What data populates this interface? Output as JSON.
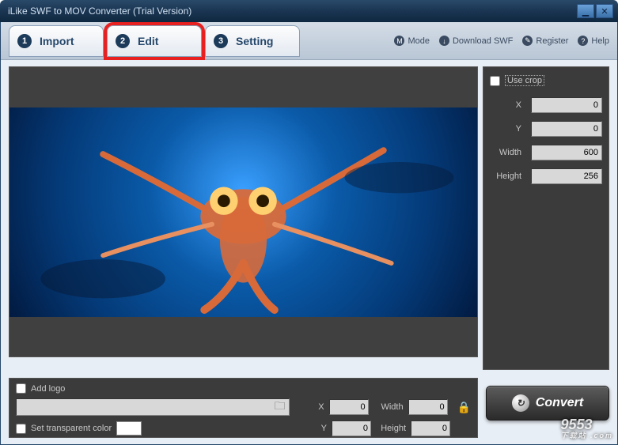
{
  "titlebar": {
    "title": "iLike SWF to MOV Converter (Trial Version)"
  },
  "tabs": {
    "import": {
      "num": "1",
      "label": "Import"
    },
    "edit": {
      "num": "2",
      "label": "Edit"
    },
    "setting": {
      "num": "3",
      "label": "Setting"
    }
  },
  "menu": {
    "mode": {
      "icon": "M",
      "label": "Mode"
    },
    "download": {
      "icon": "↓",
      "label": "Download SWF"
    },
    "register": {
      "icon": "✎",
      "label": "Register"
    },
    "help": {
      "icon": "?",
      "label": "Help"
    }
  },
  "crop": {
    "use_label": "Use crop",
    "x_label": "X",
    "x_value": "0",
    "y_label": "Y",
    "y_value": "0",
    "w_label": "Width",
    "w_value": "600",
    "h_label": "Height",
    "h_value": "256"
  },
  "logo": {
    "add_label": "Add logo",
    "path_value": "",
    "x_label": "X",
    "x_value": "0",
    "y_label": "Y",
    "y_value": "0",
    "w_label": "Width",
    "w_value": "0",
    "h_label": "Height",
    "h_value": "0",
    "transparent_label": "Set transparent color"
  },
  "convert_label": "Convert",
  "watermark": {
    "main": "9553",
    "sub": "下载站 .com"
  }
}
